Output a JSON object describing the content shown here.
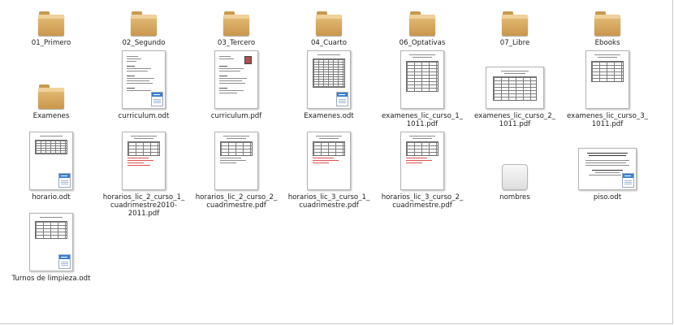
{
  "files": [
    {
      "name": "01_Primero"
    },
    {
      "name": "02_Segundo"
    },
    {
      "name": "03_Tercero"
    },
    {
      "name": "04_Cuarto"
    },
    {
      "name": "06_Optativas"
    },
    {
      "name": "07_Libre"
    },
    {
      "name": "Ebooks"
    },
    {
      "name": "Examenes"
    },
    {
      "name": "curriculum.odt"
    },
    {
      "name": "curriculum.pdf"
    },
    {
      "name": "Examenes.odt"
    },
    {
      "name": "examenes_lic_curso_1_\n1011.pdf"
    },
    {
      "name": "examenes_lic_curso_2_\n1011.pdf"
    },
    {
      "name": "examenes_lic_curso_3_\n1011.pdf"
    },
    {
      "name": "horario.odt"
    },
    {
      "name": "horarios_lic_2_curso_1_\ncuadrimestre2010-2011.pdf"
    },
    {
      "name": "horarios_lic_2_curso_2_\ncuadrimestre.pdf"
    },
    {
      "name": "horarios_lic_3_curso_1_\ncuadrimestre.pdf"
    },
    {
      "name": "horarios_lic_3_curso_2_\ncuadrimestre.pdf"
    },
    {
      "name": "nombres"
    },
    {
      "name": "piso.odt"
    },
    {
      "name": "Turnos de limpieza.odt"
    }
  ],
  "icons": {
    "folder": "folder-icon",
    "odt": "odt-document-icon",
    "pdf": "pdf-document-icon",
    "blank": "generic-file-icon"
  }
}
